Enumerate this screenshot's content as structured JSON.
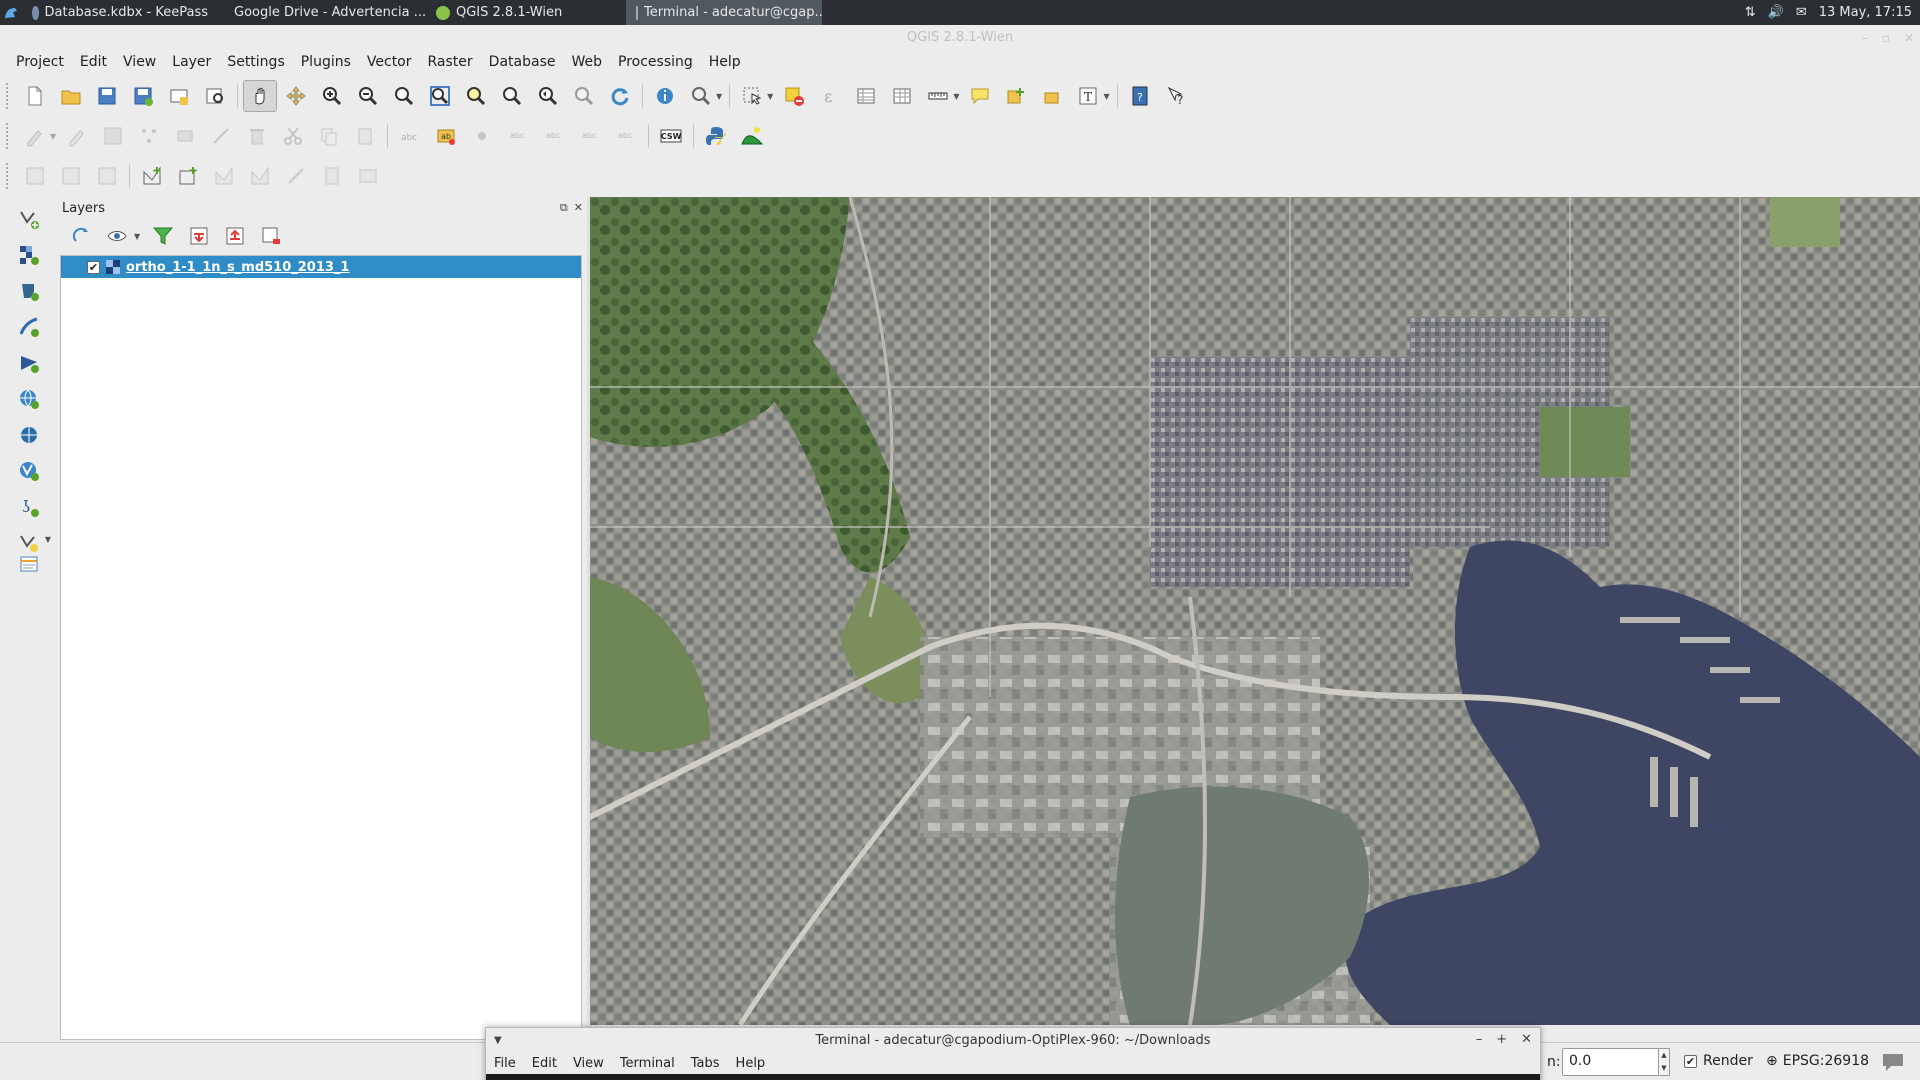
{
  "panel": {
    "tasks": [
      {
        "label": "Database.kdbx - KeePass",
        "active": false
      },
      {
        "label": "Google Drive - Advertencia ...",
        "active": false
      },
      {
        "label": "QGIS 2.8.1-Wien",
        "active": false
      },
      {
        "label": "Terminal - adecatur@cgap...",
        "active": true
      }
    ],
    "clock": "13 May, 17:15"
  },
  "window": {
    "title": "QGIS 2.8.1-Wien"
  },
  "menubar": [
    "Project",
    "Edit",
    "View",
    "Layer",
    "Settings",
    "Plugins",
    "Vector",
    "Raster",
    "Database",
    "Web",
    "Processing",
    "Help"
  ],
  "layers_panel": {
    "title": "Layers",
    "layers": [
      {
        "name": "ortho_1-1_1n_s_md510_2013_1",
        "checked": true,
        "selected": true
      }
    ]
  },
  "toolbar2": {
    "csw_label": "CSW"
  },
  "statusbar": {
    "rotation_label": "n:",
    "rotation_value": "0.0",
    "render_label": "Render",
    "render_checked": true,
    "crs_label": "EPSG:26918"
  },
  "terminal": {
    "title": "Terminal - adecatur@cgapodium-OptiPlex-960: ~/Downloads",
    "menu": [
      "File",
      "Edit",
      "View",
      "Terminal",
      "Tabs",
      "Help"
    ]
  },
  "colors": {
    "selection": "#308cc6",
    "panel_bg": "#2b2f33",
    "water": "#3e4663",
    "harbor_water": "#6f7a70"
  }
}
